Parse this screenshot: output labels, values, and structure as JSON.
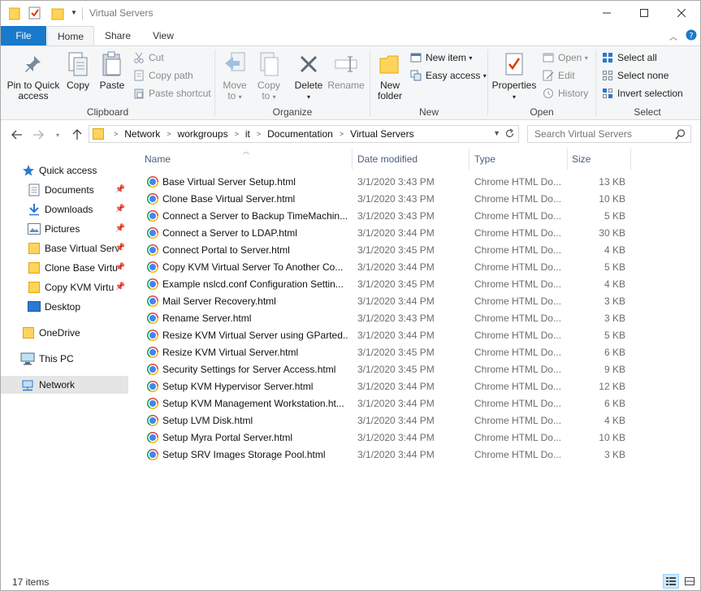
{
  "window": {
    "title": "Virtual Servers"
  },
  "ribbon_tabs": [
    "File",
    "Home",
    "Share",
    "View"
  ],
  "ribbon": {
    "clipboard": {
      "label": "Clipboard",
      "pin": "Pin to Quick access",
      "copy": "Copy",
      "paste": "Paste",
      "cut": "Cut",
      "copy_path": "Copy path",
      "paste_shortcut": "Paste shortcut"
    },
    "organize": {
      "label": "Organize",
      "move_to": "Move to",
      "copy_to": "Copy to",
      "delete": "Delete",
      "rename": "Rename"
    },
    "new": {
      "label": "New",
      "new_folder": "New folder",
      "new_item": "New item",
      "easy_access": "Easy access"
    },
    "open": {
      "label": "Open",
      "properties": "Properties",
      "open": "Open",
      "edit": "Edit",
      "history": "History"
    },
    "select": {
      "label": "Select",
      "select_all": "Select all",
      "select_none": "Select none",
      "invert_selection": "Invert selection"
    }
  },
  "address": {
    "crumbs": [
      "Network",
      "workgroups",
      "it",
      "Documentation",
      "Virtual Servers"
    ],
    "search_placeholder": "Search Virtual Servers"
  },
  "navpane": {
    "items": [
      {
        "label": "Quick access",
        "icon": "star-icon"
      },
      {
        "label": "Documents",
        "icon": "documents-icon",
        "pinned": true
      },
      {
        "label": "Downloads",
        "icon": "download-icon",
        "pinned": true
      },
      {
        "label": "Pictures",
        "icon": "pictures-icon",
        "pinned": true
      },
      {
        "label": "Base Virtual Serv",
        "icon": "folder-icon",
        "pinned": true
      },
      {
        "label": "Clone Base Virtu",
        "icon": "folder-icon",
        "pinned": true
      },
      {
        "label": "Copy KVM Virtu",
        "icon": "folder-icon",
        "pinned": true
      },
      {
        "label": "Desktop",
        "icon": "desktop-icon"
      },
      {
        "label": "OneDrive",
        "icon": "folder-icon"
      },
      {
        "label": "This PC",
        "icon": "computer-icon"
      },
      {
        "label": "Network",
        "icon": "network-icon",
        "selected": true
      }
    ]
  },
  "columns": {
    "name": "Name",
    "date": "Date modified",
    "type": "Type",
    "size": "Size"
  },
  "files": [
    {
      "name": "Base Virtual Server Setup.html",
      "date": "3/1/2020 3:43 PM",
      "type": "Chrome HTML Do...",
      "size": "13 KB"
    },
    {
      "name": "Clone Base Virtual Server.html",
      "date": "3/1/2020 3:43 PM",
      "type": "Chrome HTML Do...",
      "size": "10 KB"
    },
    {
      "name": "Connect a Server to Backup TimeMachin...",
      "date": "3/1/2020 3:43 PM",
      "type": "Chrome HTML Do...",
      "size": "5 KB"
    },
    {
      "name": "Connect a Server to LDAP.html",
      "date": "3/1/2020 3:44 PM",
      "type": "Chrome HTML Do...",
      "size": "30 KB"
    },
    {
      "name": "Connect Portal to Server.html",
      "date": "3/1/2020 3:45 PM",
      "type": "Chrome HTML Do...",
      "size": "4 KB"
    },
    {
      "name": "Copy KVM Virtual Server To Another Co...",
      "date": "3/1/2020 3:44 PM",
      "type": "Chrome HTML Do...",
      "size": "5 KB"
    },
    {
      "name": "Example nslcd.conf Configuration Settin...",
      "date": "3/1/2020 3:45 PM",
      "type": "Chrome HTML Do...",
      "size": "4 KB"
    },
    {
      "name": "Mail Server Recovery.html",
      "date": "3/1/2020 3:44 PM",
      "type": "Chrome HTML Do...",
      "size": "3 KB"
    },
    {
      "name": "Rename Server.html",
      "date": "3/1/2020 3:43 PM",
      "type": "Chrome HTML Do...",
      "size": "3 KB"
    },
    {
      "name": "Resize KVM Virtual Server using GParted....",
      "date": "3/1/2020 3:44 PM",
      "type": "Chrome HTML Do...",
      "size": "5 KB"
    },
    {
      "name": "Resize KVM Virtual Server.html",
      "date": "3/1/2020 3:45 PM",
      "type": "Chrome HTML Do...",
      "size": "6 KB"
    },
    {
      "name": "Security Settings for Server Access.html",
      "date": "3/1/2020 3:45 PM",
      "type": "Chrome HTML Do...",
      "size": "9 KB"
    },
    {
      "name": "Setup KVM Hypervisor Server.html",
      "date": "3/1/2020 3:44 PM",
      "type": "Chrome HTML Do...",
      "size": "12 KB"
    },
    {
      "name": "Setup KVM Management Workstation.ht...",
      "date": "3/1/2020 3:44 PM",
      "type": "Chrome HTML Do...",
      "size": "6 KB"
    },
    {
      "name": "Setup LVM Disk.html",
      "date": "3/1/2020 3:44 PM",
      "type": "Chrome HTML Do...",
      "size": "4 KB"
    },
    {
      "name": "Setup Myra Portal Server.html",
      "date": "3/1/2020 3:44 PM",
      "type": "Chrome HTML Do...",
      "size": "10 KB"
    },
    {
      "name": "Setup SRV Images Storage Pool.html",
      "date": "3/1/2020 3:44 PM",
      "type": "Chrome HTML Do...",
      "size": "3 KB"
    }
  ],
  "status": {
    "item_count": "17 items"
  },
  "colors": {
    "accent": "#1979ca",
    "folder": "#ffd35c",
    "header_text": "#4c607a",
    "selected_nav": "#e5e5e5"
  }
}
